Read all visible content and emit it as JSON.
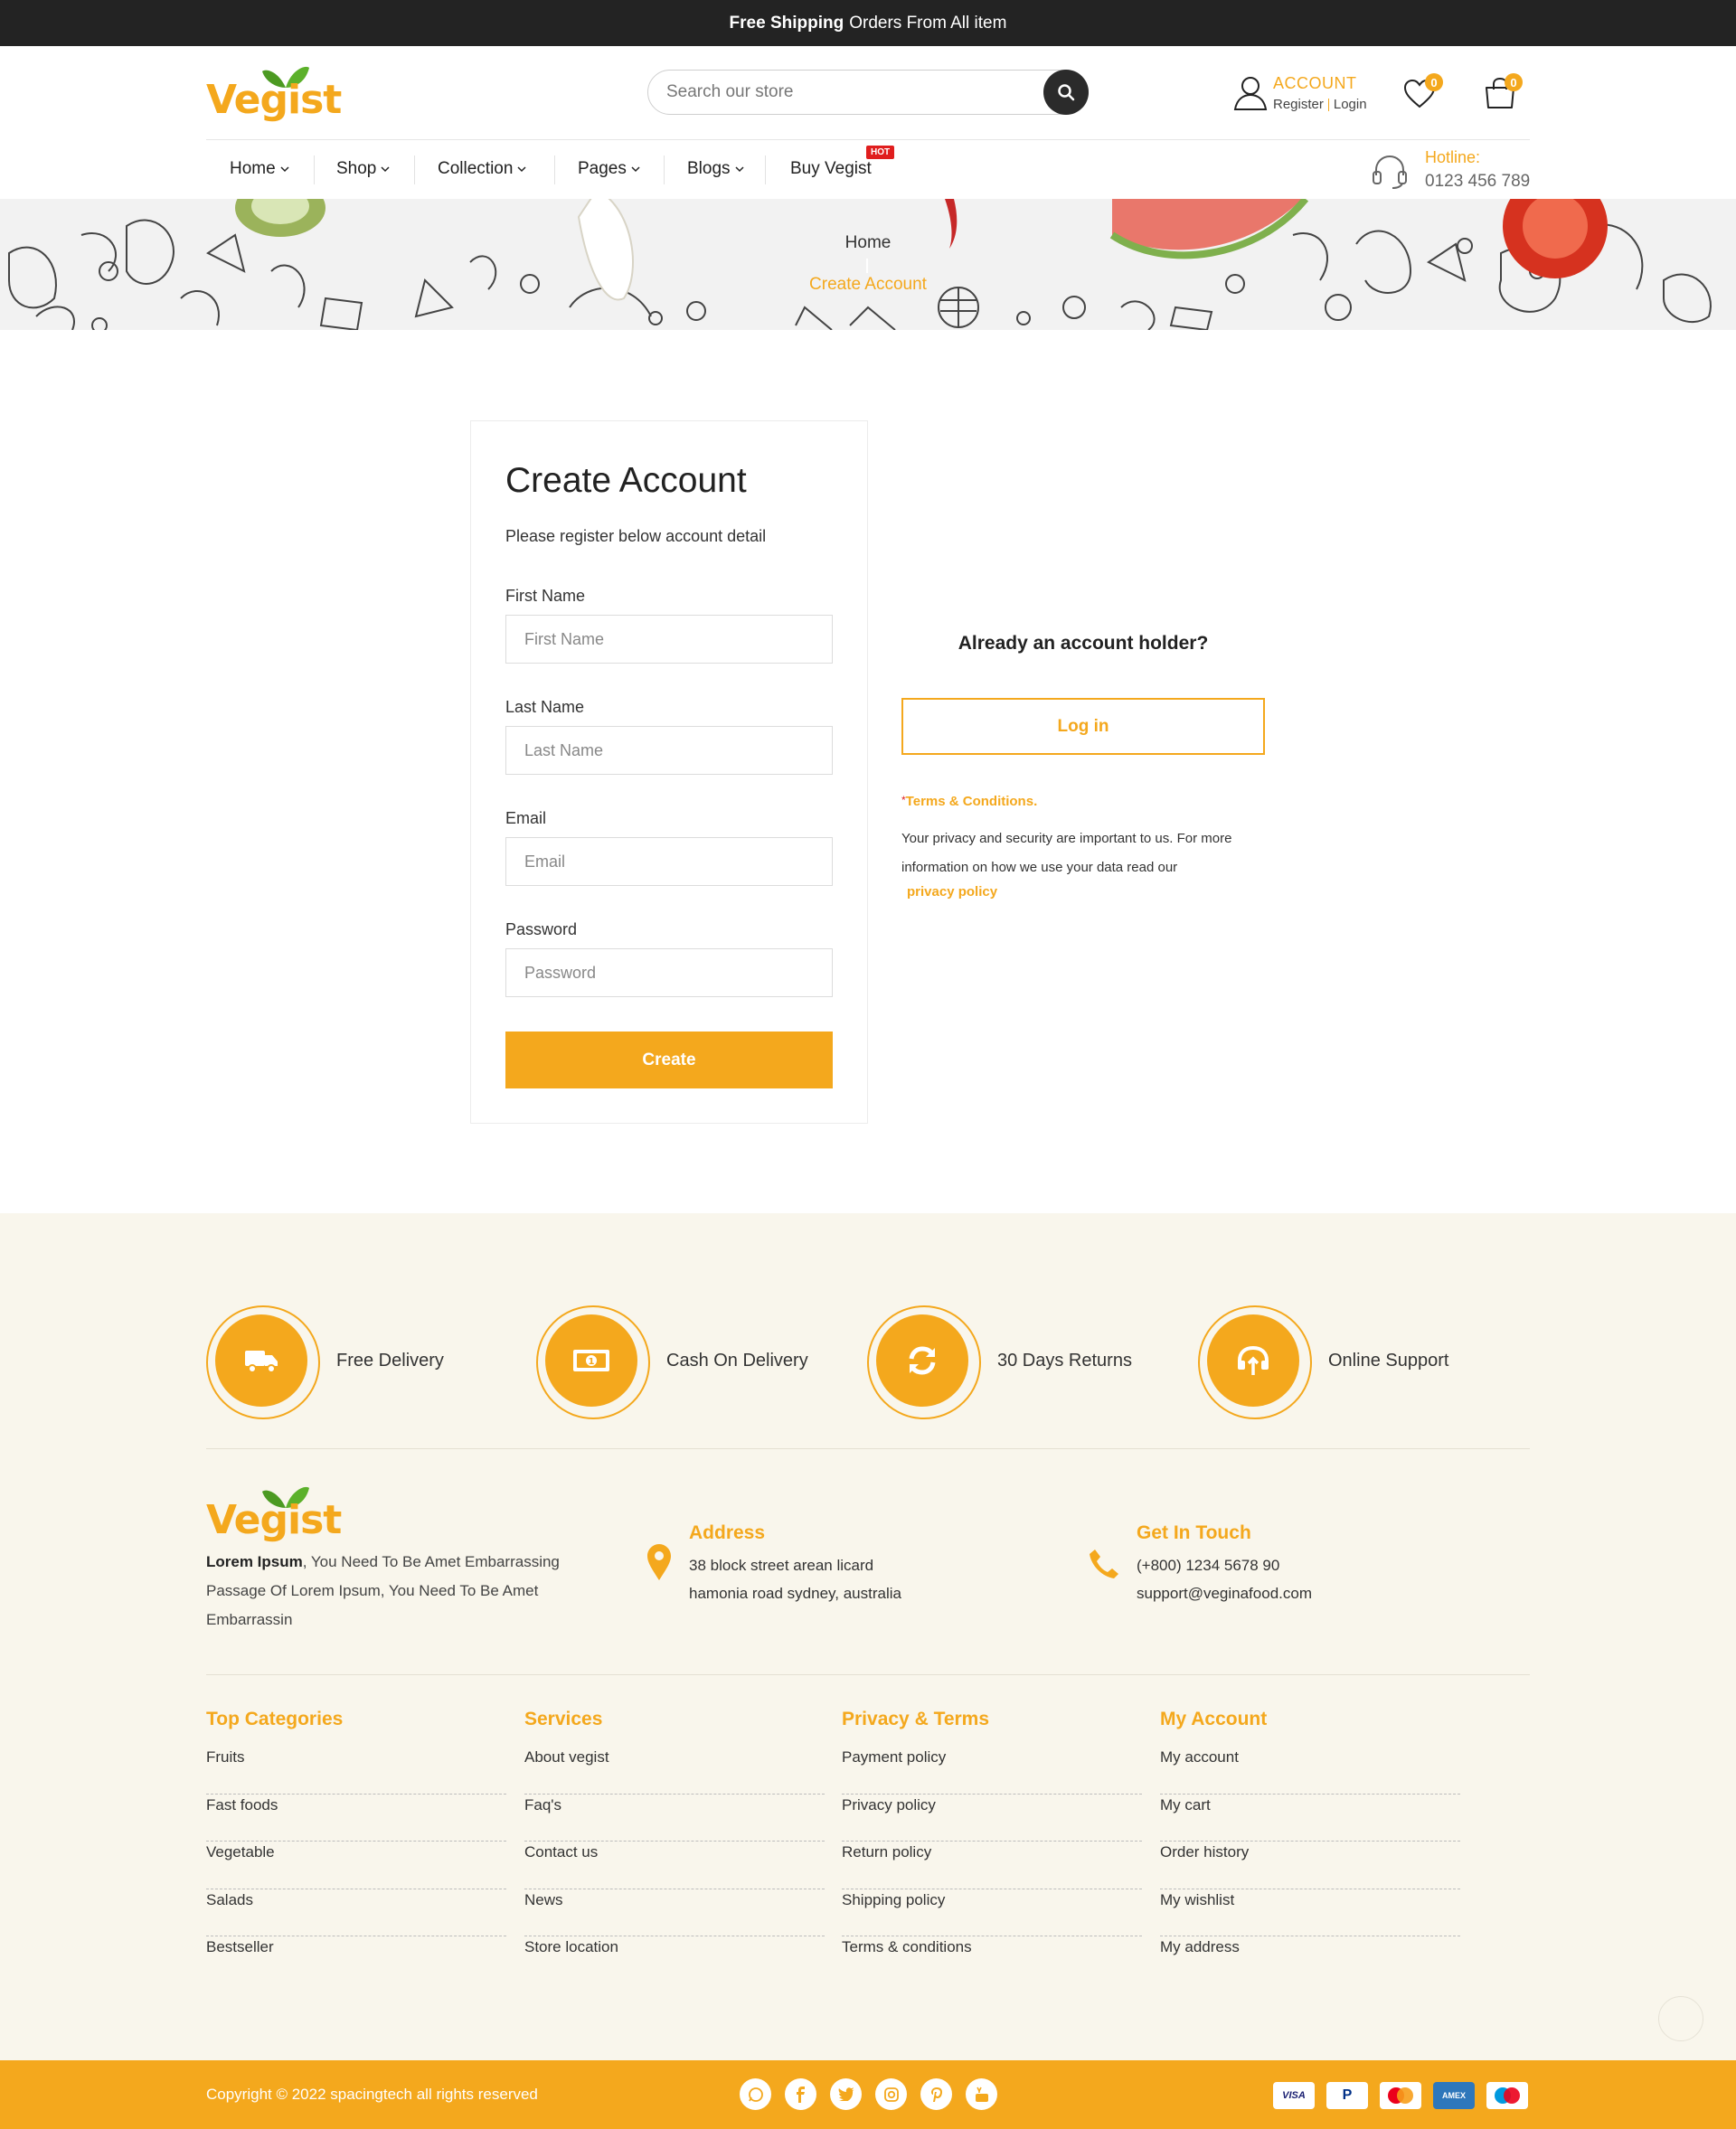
{
  "topbar": {
    "bold": "Free Shipping",
    "text": "Orders From All item"
  },
  "brand": {
    "name": "Vegist",
    "accent": "#f4a81d",
    "dark": "#232323"
  },
  "search": {
    "placeholder": "Search our store",
    "icon": "search-icon"
  },
  "account": {
    "label": "ACCOUNT",
    "register": "Register",
    "login": "Login"
  },
  "wishlist": {
    "count": "0",
    "icon": "heart-icon"
  },
  "cart": {
    "count": "0",
    "icon": "bag-icon"
  },
  "nav": {
    "items": [
      {
        "label": "Home"
      },
      {
        "label": "Shop"
      },
      {
        "label": "Collection"
      },
      {
        "label": "Pages"
      },
      {
        "label": "Blogs"
      },
      {
        "label": "Buy Vegist"
      }
    ],
    "hot_badge": "HOT",
    "hotline_label": "Hotline:",
    "hotline_number": "0123 456 789"
  },
  "breadcrumb": {
    "home": "Home",
    "current": "Create Account"
  },
  "form": {
    "title": "Create Account",
    "subtitle": "Please register below account detail",
    "first_name_label": "First Name",
    "first_name_placeholder": "First Name",
    "last_name_label": "Last Name",
    "last_name_placeholder": "Last Name",
    "email_label": "Email",
    "email_placeholder": "Email",
    "password_label": "Password",
    "password_placeholder": "Password",
    "submit": "Create"
  },
  "side": {
    "holder_text": "Already an account holder?",
    "login_button": "Log in",
    "terms_star": "*",
    "terms_title": "Terms & Conditions.",
    "terms_text": "Your privacy and security are important to us. For more information on how we use your data read our",
    "privacy_link": "privacy policy"
  },
  "features": [
    {
      "label": "Free Delivery",
      "icon": "truck-icon"
    },
    {
      "label": "Cash On Delivery",
      "icon": "cash-icon"
    },
    {
      "label": "30 Days Returns",
      "icon": "refresh-icon"
    },
    {
      "label": "Online Support",
      "icon": "support-icon"
    }
  ],
  "about": {
    "bold": "Lorem Ipsum",
    "text": ", You Need To Be Amet Embarrassing Passage Of Lorem Ipsum, You Need To Be Amet Embarrassin"
  },
  "address": {
    "title": "Address",
    "line1": "38 block street arean licard",
    "line2": "hamonia road sydney, australia"
  },
  "contact": {
    "title": "Get In Touch",
    "phone": "(+800) 1234 5678 90",
    "email": "support@veginafood.com"
  },
  "columns": [
    {
      "title": "Top Categories",
      "links": [
        "Fruits",
        "Fast foods",
        "Vegetable",
        "Salads",
        "Bestseller"
      ]
    },
    {
      "title": "Services",
      "links": [
        "About vegist",
        "Faq's",
        "Contact us",
        "News",
        "Store location"
      ]
    },
    {
      "title": "Privacy & Terms",
      "links": [
        "Payment policy",
        "Privacy policy",
        "Return policy",
        "Shipping policy",
        "Terms & conditions"
      ]
    },
    {
      "title": "My Account",
      "links": [
        "My account",
        "My cart",
        "Order history",
        "My wishlist",
        "My address"
      ]
    }
  ],
  "bottom": {
    "copyright": "Copyright © 2022 spacingtech all rights reserved",
    "socials": [
      "whatsapp-icon",
      "facebook-icon",
      "twitter-icon",
      "instagram-icon",
      "pinterest-icon",
      "youtube-icon"
    ],
    "payments": [
      {
        "name": "VISA"
      },
      {
        "name": "P"
      },
      {
        "name": "mastercard"
      },
      {
        "name": "AMEX"
      },
      {
        "name": "maestro"
      }
    ]
  }
}
